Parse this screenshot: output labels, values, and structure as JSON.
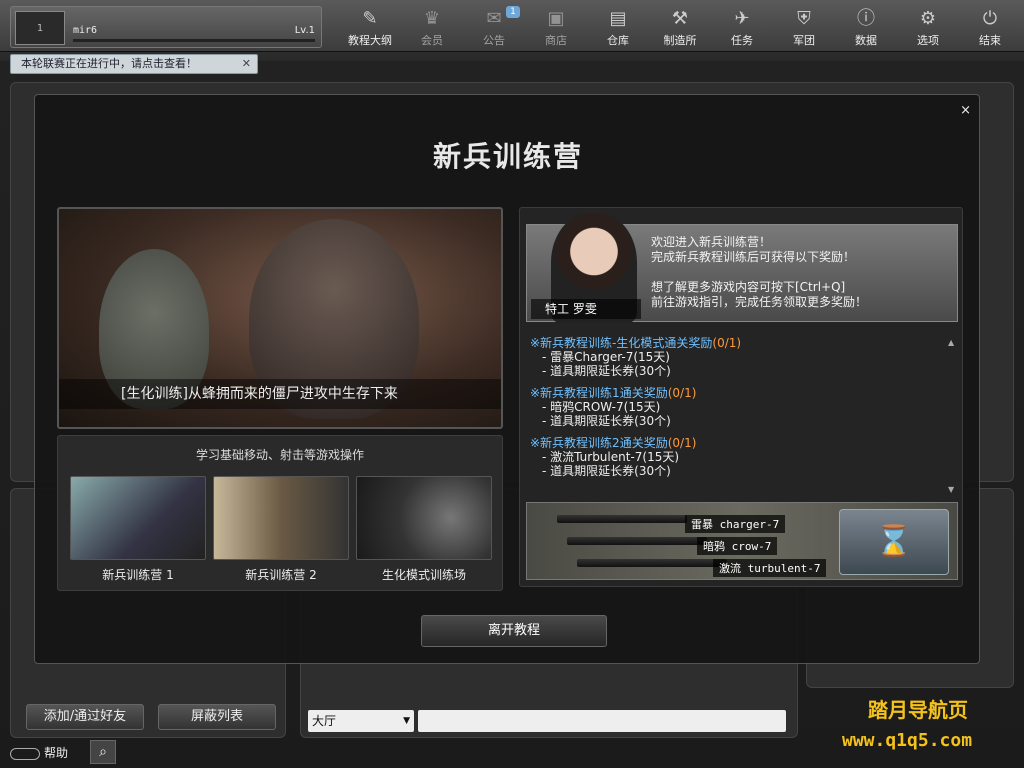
{
  "profile": {
    "name": "mir6",
    "level": "Lv.1",
    "avatar_text": "1"
  },
  "nav": [
    {
      "label": "教程大纲",
      "icon": "✎",
      "dim": false
    },
    {
      "label": "会员",
      "icon": "♛",
      "dim": true
    },
    {
      "label": "公告",
      "icon": "✉",
      "dim": true
    },
    {
      "label": "商店",
      "icon": "▣",
      "dim": true
    },
    {
      "label": "仓库",
      "icon": "▤",
      "dim": false
    },
    {
      "label": "制造所",
      "icon": "⚒",
      "dim": false
    },
    {
      "label": "任务",
      "icon": "✈",
      "dim": false
    },
    {
      "label": "军团",
      "icon": "⛨",
      "dim": false
    },
    {
      "label": "数据",
      "icon": "ⓘ",
      "dim": false
    },
    {
      "label": "选项",
      "icon": "⚙",
      "dim": false
    },
    {
      "label": "结束",
      "icon": "⏻",
      "dim": false
    }
  ],
  "nav_badge": "1",
  "notice": {
    "text": "本轮联赛正在进行中，请点击查看！",
    "close": "✕"
  },
  "modal": {
    "title": "新兵训练营",
    "close": "×",
    "hero_caption": "[生化训练]从蜂拥而来的僵尸进攻中生存下来",
    "modes_header": "学习基础移动、射击等游戏操作",
    "modes": [
      {
        "label": "新兵训练营 1"
      },
      {
        "label": "新兵训练营 2"
      },
      {
        "label": "生化模式训练场"
      }
    ],
    "npc": {
      "name": "特工 罗雯",
      "lines": [
        "欢迎进入新兵训练营！",
        "完成新兵教程训练后可获得以下奖励！",
        "",
        "想了解更多游戏内容可按下[Ctrl+Q]",
        "前往游戏指引，完成任务领取更多奖励！"
      ]
    },
    "rewards": [
      {
        "title": "※新兵教程训练-生化模式通关奖励",
        "count": "(0/1)",
        "items": [
          "- 雷暴Charger-7(15天)",
          "- 道具期限延长券(30个)"
        ]
      },
      {
        "title": "※新兵教程训练1通关奖励",
        "count": "(0/1)",
        "items": [
          "- 暗鸦CROW-7(15天)",
          "- 道具期限延长券(30个)"
        ]
      },
      {
        "title": "※新兵教程训练2通关奖励",
        "count": "(0/1)",
        "items": [
          "- 激流Turbulent-7(15天)",
          "- 道具期限延长券(30个)"
        ]
      }
    ],
    "weapons": [
      "雷暴 charger-7",
      "暗鸦 crow-7",
      "激流 turbulent-7"
    ],
    "leave_button": "离开教程"
  },
  "bottom": {
    "add_friend": "添加/通过好友",
    "block_list": "屏蔽列表",
    "channel": "大厅",
    "help": "帮助"
  },
  "watermark": {
    "line1": "踏月导航页",
    "line2": "www.q1q5.com"
  }
}
